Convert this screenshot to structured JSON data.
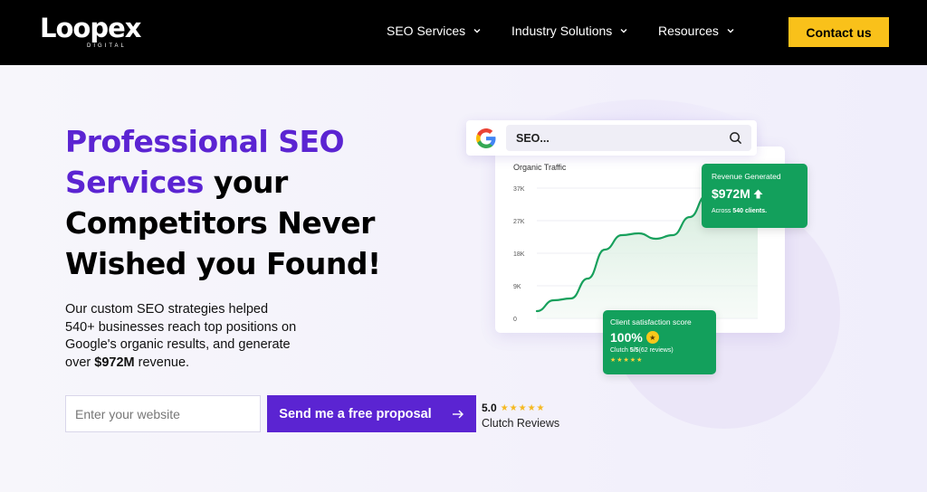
{
  "brand": {
    "logo_text": "Loopex",
    "logo_sub": "DIGITAL"
  },
  "nav": {
    "items": [
      {
        "label": "SEO Services"
      },
      {
        "label": "Industry Solutions"
      },
      {
        "label": "Resources"
      }
    ],
    "cta_label": "Contact us"
  },
  "hero": {
    "headline_accent": "Professional SEO Services",
    "headline_rest": "your Competitors Never Wished you Found!",
    "subcopy_prefix": "Our custom SEO strategies helped 540+ businesses reach top positions on Google's organic results, and generate over ",
    "subcopy_bold": "$972M",
    "subcopy_suffix": " revenue.",
    "input_placeholder": "Enter your website",
    "button_label": "Send me a free proposal",
    "rating_score": "5.0",
    "rating_label": "Clutch Reviews",
    "rating_stars": 5
  },
  "illustration": {
    "search_query": "SEO...",
    "revenue": {
      "title": "Revenue Generated",
      "value": "$972M",
      "footnote_prefix": "Across ",
      "footnote_bold": "540 clients.",
      "footnote_suffix": ""
    },
    "satisfaction": {
      "title": "Client satisfaction score",
      "value": "100%",
      "clutch_prefix": "Clutch ",
      "clutch_bold": "5/5",
      "clutch_suffix": "(62 reviews)",
      "stars": 5
    }
  },
  "chart_data": {
    "type": "area",
    "title": "Organic Traffic",
    "xlabel": "",
    "ylabel": "",
    "y_ticks": [
      "0",
      "9K",
      "18K",
      "27K",
      "37K"
    ],
    "ylim": [
      0,
      37000
    ],
    "x": [
      0,
      1,
      2,
      3,
      4,
      5,
      6,
      7,
      8,
      9,
      10,
      11,
      12,
      13
    ],
    "series": [
      {
        "values": [
          2000,
          5000,
          5500,
          11000,
          19000,
          23000,
          23500,
          22000,
          23000,
          28000,
          34000,
          34500,
          33000,
          34000
        ]
      }
    ],
    "grid": true,
    "color": "#17a05c"
  }
}
